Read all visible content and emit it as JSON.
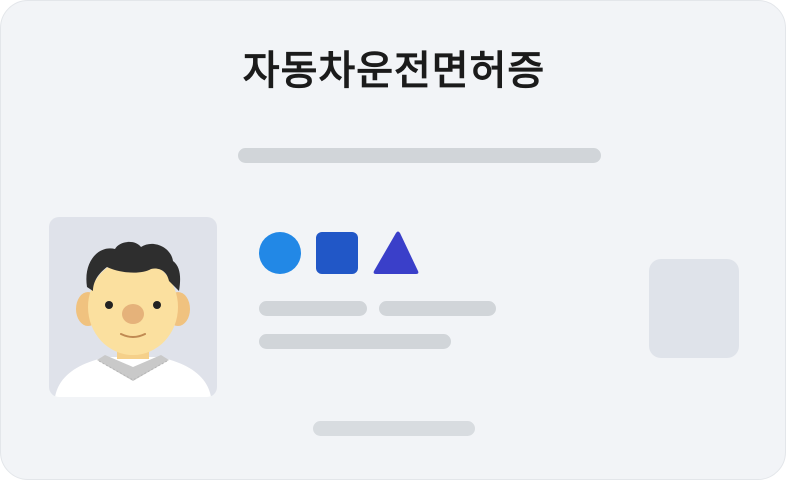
{
  "card": {
    "title": "자동차운전면허증",
    "shapes": [
      {
        "icon": "circle-icon",
        "color": "#2288e6"
      },
      {
        "icon": "square-icon",
        "color": "#2157c7"
      },
      {
        "icon": "triangle-icon",
        "color": "#3a3fc9"
      }
    ],
    "colors": {
      "background": "#f2f4f7",
      "placeholder": "#d1d5d9",
      "photo_bg": "#dfe2ea",
      "chip": "#dfe3ea"
    },
    "icons": {
      "photo": "person-avatar-icon",
      "chip": "ic-chip-icon"
    }
  }
}
